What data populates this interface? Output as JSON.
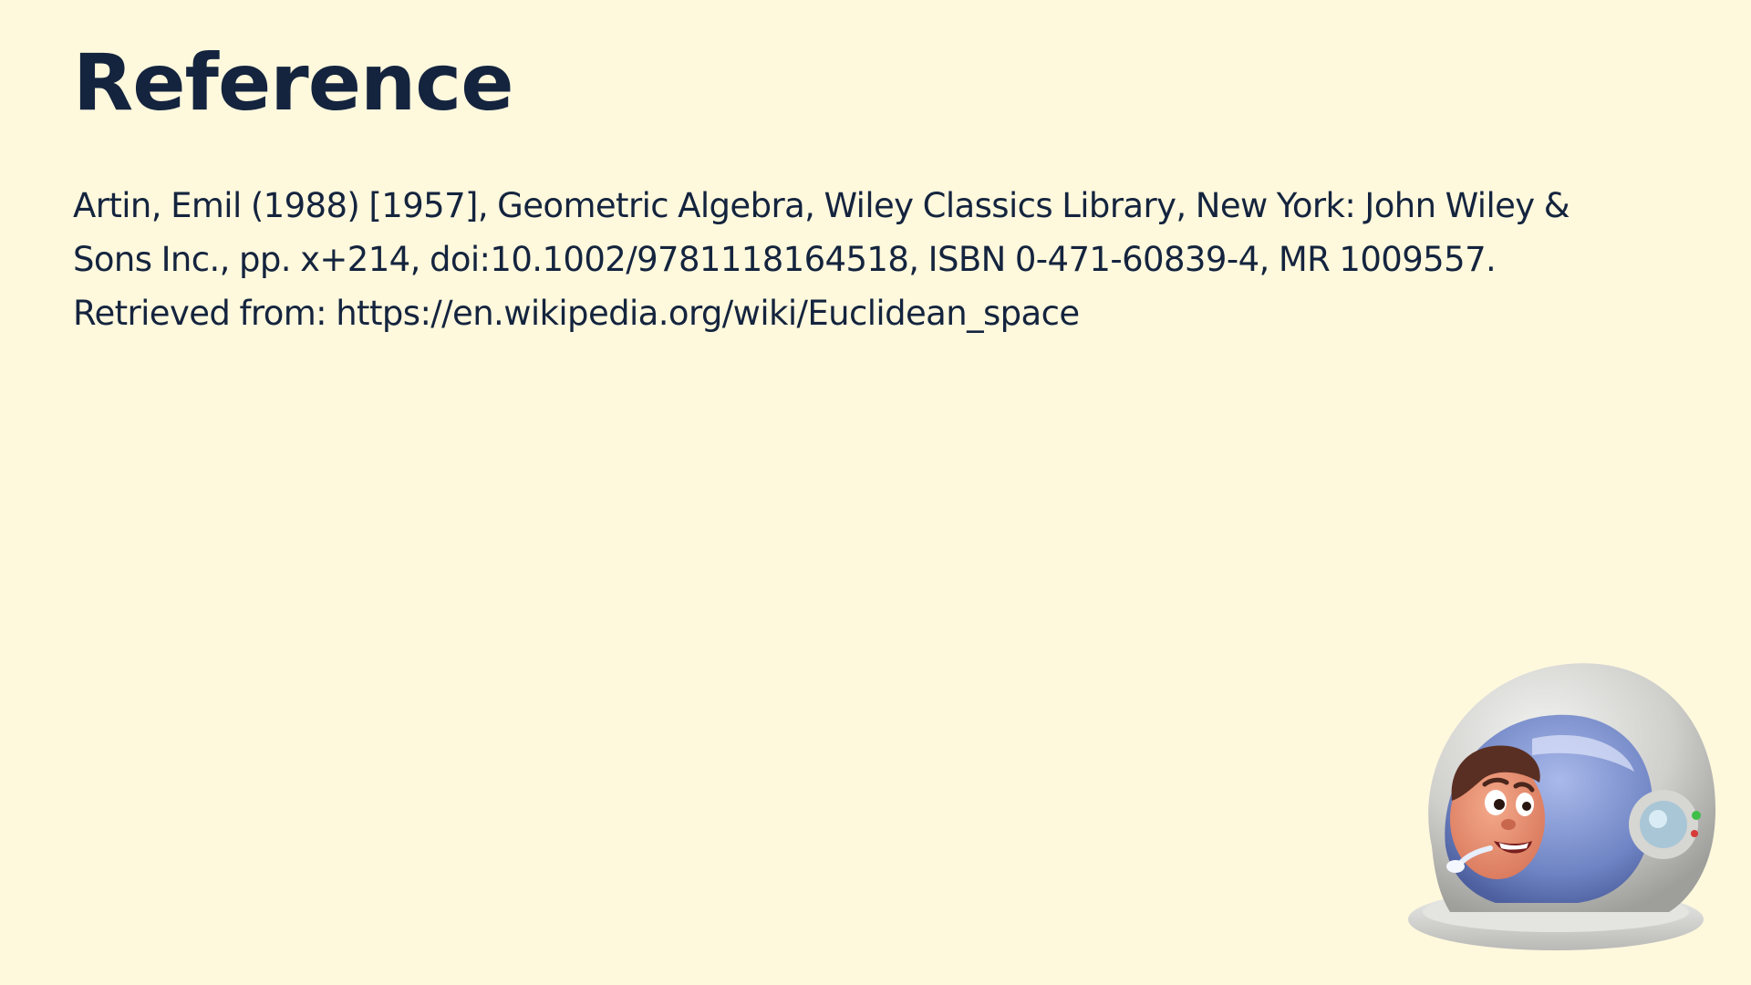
{
  "slide": {
    "title": "Reference",
    "citation": "Artin, Emil (1988) [1957], Geometric Algebra, Wiley Classics Library, New York: John Wiley & Sons Inc., pp. x+214, doi:10.1002/9781118164518, ISBN 0-471-60839-4, MR 1009557. Retrieved from:  https://en.wikipedia.org/wiki/Euclidean_space"
  },
  "illustration": {
    "icon": "astronaut-icon"
  },
  "colors": {
    "background": "#fef8dd",
    "text": "#14243e"
  }
}
